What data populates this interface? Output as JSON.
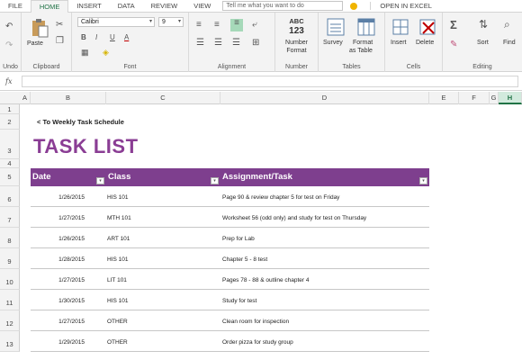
{
  "menu": {
    "tabs": [
      "FILE",
      "HOME",
      "INSERT",
      "DATA",
      "REVIEW",
      "VIEW"
    ],
    "active": "HOME",
    "tell_me_placeholder": "Tell me what you want to do",
    "open_in_excel": "OPEN IN EXCEL"
  },
  "ribbon": {
    "undo_label": "Undo",
    "clipboard": {
      "paste": "Paste",
      "label": "Clipboard"
    },
    "font": {
      "name": "Calibri",
      "size": "9",
      "bold": "B",
      "italic": "I",
      "underline": "U",
      "font_color": "A",
      "label": "Font"
    },
    "alignment": {
      "label": "Alignment"
    },
    "number": {
      "abc": "ABC",
      "digits": "123",
      "format_line1": "Number",
      "format_line2": "Format",
      "label": "Number"
    },
    "tables": {
      "survey": "Survey",
      "format_line1": "Format",
      "format_line2": "as Table",
      "label": "Tables"
    },
    "cells": {
      "insert": "Insert",
      "delete": "Delete",
      "label": "Cells"
    },
    "editing": {
      "sort": "Sort",
      "find": "Find",
      "label": "Editing"
    }
  },
  "formula_bar": {
    "fx": "fx",
    "value": ""
  },
  "columns": [
    "A",
    "B",
    "C",
    "D",
    "E",
    "F",
    "G",
    "H"
  ],
  "selected_column": "H",
  "rows": [
    "1",
    "2",
    "3",
    "4",
    "5",
    "6",
    "7",
    "8",
    "9",
    "10",
    "11",
    "12",
    "13"
  ],
  "sheet": {
    "back_link": "< To Weekly Task Schedule",
    "title": "TASK LIST",
    "headers": {
      "date": "Date",
      "class": "Class",
      "task": "Assignment/Task"
    },
    "tasks": [
      {
        "date": "1/26/2015",
        "class": "HIS 101",
        "task": "Page 90 & review chapter 5 for test on Friday"
      },
      {
        "date": "1/27/2015",
        "class": "MTH 101",
        "task": "Worksheet 56 (odd only) and study for test on Thursday"
      },
      {
        "date": "1/26/2015",
        "class": "ART 101",
        "task": "Prep for Lab"
      },
      {
        "date": "1/28/2015",
        "class": "HIS 101",
        "task": "Chapter 5 - 8 test"
      },
      {
        "date": "1/27/2015",
        "class": "LIT 101",
        "task": "Pages 78 - 88 & outline chapter 4"
      },
      {
        "date": "1/30/2015",
        "class": "HIS 101",
        "task": "Study for test"
      },
      {
        "date": "1/27/2015",
        "class": "OTHER",
        "task": "Clean room for inspection"
      },
      {
        "date": "1/29/2015",
        "class": "OTHER",
        "task": "Order pizza for study group"
      }
    ]
  },
  "colors": {
    "accent": "#217346",
    "header_fill": "#7e3f8e",
    "title": "#8a3d94"
  }
}
